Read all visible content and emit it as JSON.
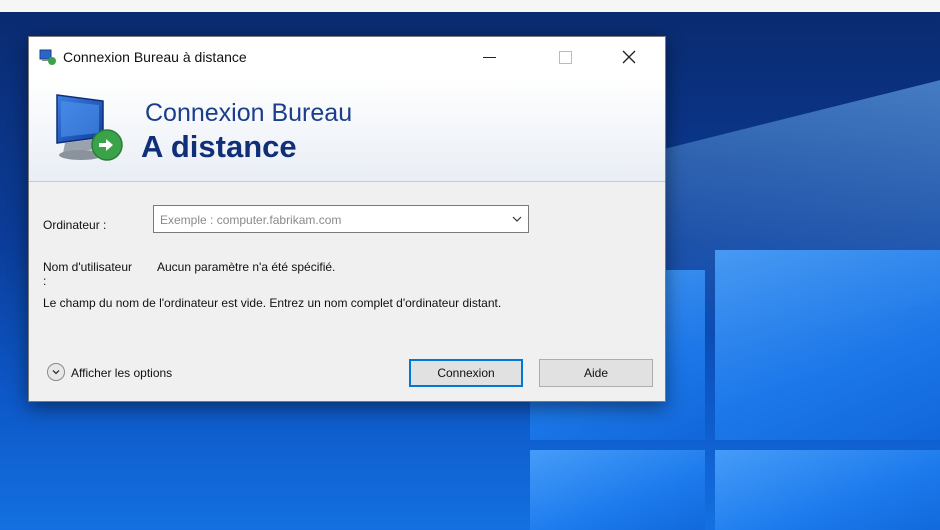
{
  "window": {
    "title": "Connexion Bureau à distance"
  },
  "banner": {
    "line1": "Connexion Bureau",
    "line2": "A distance"
  },
  "form": {
    "computer_label": "Ordinateur :",
    "computer_placeholder": "Exemple : computer.fabrikam.com",
    "username_label": "Nom d'utilisateur :",
    "username_value": "Aucun paramètre n'a été spécifié.",
    "message": "Le champ du nom de l'ordinateur est vide. Entrez un nom complet d'ordinateur distant."
  },
  "footer": {
    "show_options_label": "Afficher les options",
    "connect_button": "Connexion",
    "help_button": "Aide"
  },
  "colors": {
    "accent": "#0078d7",
    "banner_text": "#1a3e8c"
  }
}
